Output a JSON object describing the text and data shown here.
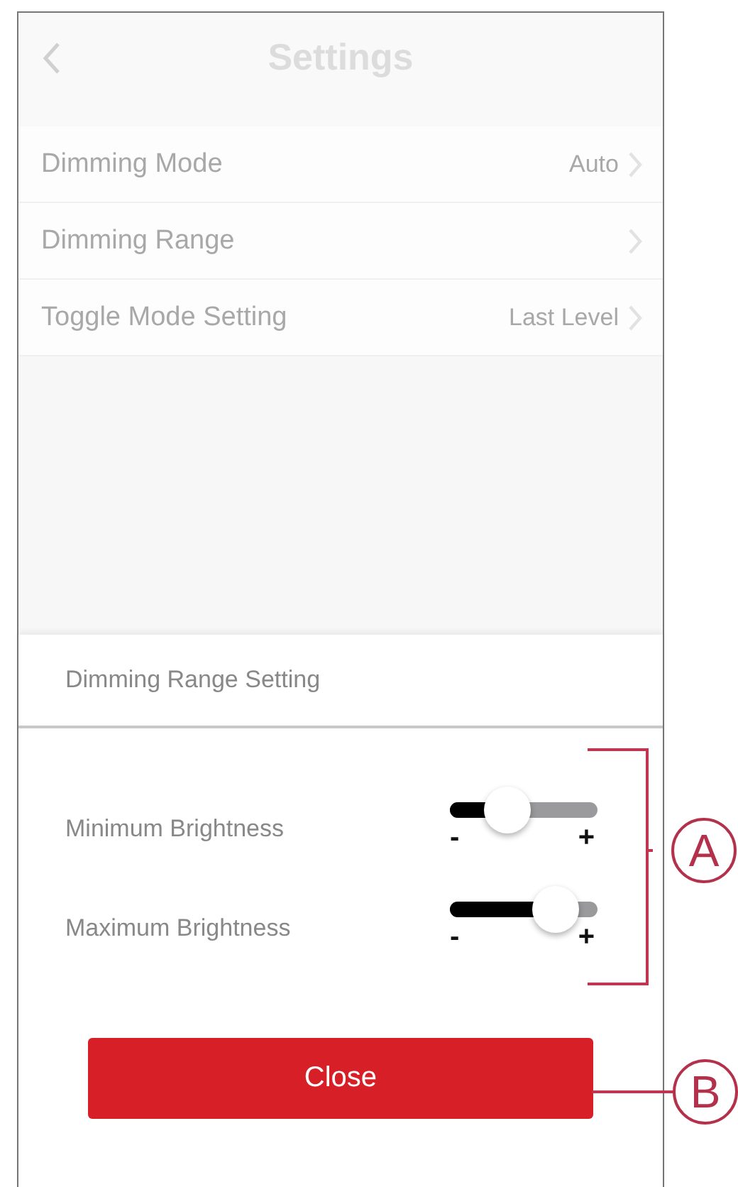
{
  "header": {
    "title": "Settings"
  },
  "settings": [
    {
      "label": "Dimming Mode",
      "value": "Auto"
    },
    {
      "label": "Dimming Range"
    },
    {
      "label": "Toggle Mode Setting",
      "value": "Last Level"
    }
  ],
  "sheet": {
    "title": "Dimming Range Setting",
    "sliders": [
      {
        "label": "Minimum Brightness",
        "level": 0.38,
        "minus": "-",
        "plus": "+"
      },
      {
        "label": "Maximum Brightness",
        "level": 0.71,
        "minus": "-",
        "plus": "+"
      }
    ],
    "button": "Close"
  },
  "callouts": [
    "A",
    "B"
  ]
}
